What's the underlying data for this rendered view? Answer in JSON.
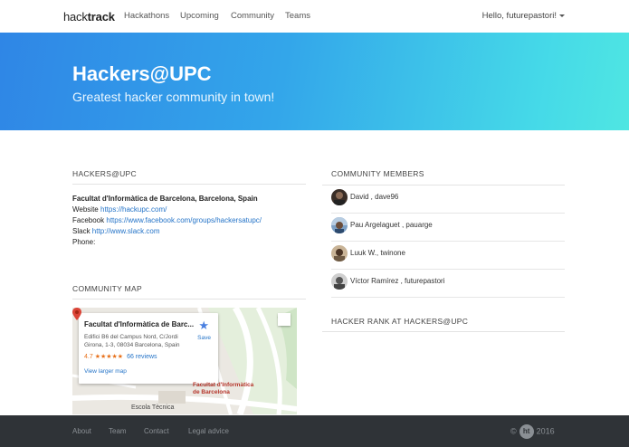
{
  "navbar": {
    "brand_light": "hack",
    "brand_bold": "track",
    "links": [
      "Hackathons",
      "Upcoming",
      "Community",
      "Teams"
    ],
    "user_menu": "Hello, futurepastori!"
  },
  "hero": {
    "title": "Hackers@UPC",
    "subtitle": "Greatest hacker community in town!",
    "gradient_start": "#2f86e6",
    "gradient_end": "#4fe6e2"
  },
  "info_section": {
    "heading": "HACKERS@UPC",
    "address": "Facultat d'Informàtica de Barcelona, Barcelona, Spain",
    "website_label": "Website",
    "website_url": "https://hackupc.com/",
    "facebook_label": "Facebook",
    "facebook_url": "https://www.facebook.com/groups/hackersatupc/",
    "slack_label": "Slack",
    "slack_url": "http://www.slack.com",
    "phone_label": "Phone:"
  },
  "map_section": {
    "heading": "COMMUNITY MAP",
    "card_title": "Facultat d'Informàtica de Barc...",
    "card_address": "Edifici B6 del Campus Nord, C/Jordi Girona, 1-3, 08034 Barcelona, Spain",
    "rating": "4.7",
    "stars": "★★★★★",
    "reviews": "66 reviews",
    "view_larger": "View larger map",
    "save": "Save",
    "pin_label_line1": "Facultat d'Informàtica",
    "pin_label_line2": "de Barcelona",
    "street_label": "Escola Tècnica"
  },
  "members_section": {
    "heading": "COMMUNITY MEMBERS",
    "members": [
      {
        "name": "David",
        "handle": "dave96"
      },
      {
        "name": "Pau Argelaguet",
        "handle": "pauarge"
      },
      {
        "name": "Luuk W.",
        "handle": "twinone"
      },
      {
        "name": "Víctor Ramírez",
        "handle": "futurepastori"
      }
    ]
  },
  "rank_section": {
    "heading": "HACKER RANK AT HACKERS@UPC"
  },
  "footer": {
    "links": [
      "About",
      "Team",
      "Contact",
      "Legal advice"
    ],
    "copyright_symbol": "©",
    "logo_text": "ht",
    "year": "2016"
  }
}
